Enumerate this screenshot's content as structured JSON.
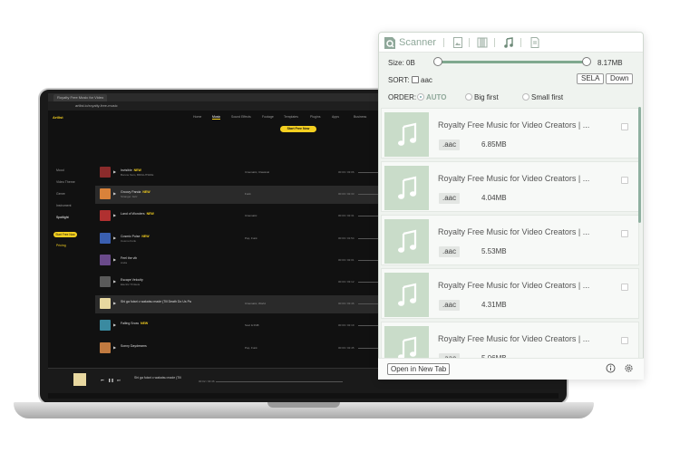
{
  "laptop": {
    "browser_tab": "Royalty Free Music for Video",
    "url": "artlist.io/royalty-free-music",
    "site_logo": "Artlist",
    "nav_items": [
      "Home",
      "Music",
      "Sound Effects",
      "Footage",
      "Templates",
      "Plugins",
      "Apps",
      "Business"
    ],
    "cta": "Start Free Now",
    "sidebar": [
      "Mood",
      "Video Theme",
      "Genre",
      "Instrument",
      "Spotlight"
    ],
    "sidebar_cta": "Start Free Now",
    "sidebar_pricing": "Pricing",
    "tracks": [
      {
        "title": "Invisible",
        "badge": "NEW",
        "artist": "Bonnie Sam, BRIGHTSIDE",
        "genre": "Cinematic, Classical",
        "duration": "00:00 / 03:06",
        "color": "#8a2b2b"
      },
      {
        "title": "Groovy Panda",
        "badge": "NEW",
        "artist": "Stranger Jazz",
        "genre": "Funk",
        "duration": "00:00 / 02:33",
        "color": "#d9823a"
      },
      {
        "title": "Land of Wonders",
        "badge": "NEW",
        "artist": "",
        "genre": "Cinematic",
        "duration": "00:00 / 02:31",
        "color": "#b03030"
      },
      {
        "title": "Cosmic Pulse",
        "badge": "NEW",
        "artist": "Cosmo Funk",
        "genre": "Pop, Funk",
        "duration": "00:00 / 01:54",
        "color": "#3a5fb0"
      },
      {
        "title": "Feel the vib",
        "badge": "",
        "artist": "Anda",
        "genre": "",
        "duration": "00:00 / 02:01",
        "color": "#6a4a8a"
      },
      {
        "title": "Escape Velocity",
        "badge": "",
        "artist": "Electric Trinkets",
        "genre": "",
        "duration": "00:00 / 03:12",
        "color": "#5a5a5a"
      },
      {
        "title": "Shi ga futari o wakatsu made (Till Death Do Us Pa",
        "badge": "",
        "artist": "",
        "genre": "Cinematic, World",
        "duration": "00:00 / 03:46",
        "color": "#e8d8a0"
      },
      {
        "title": "Falling Snow",
        "badge": "NEW",
        "artist": "",
        "genre": "Soul & RnB",
        "duration": "00:00 / 02:19",
        "color": "#3a8aa0"
      },
      {
        "title": "Sonny Daydreams",
        "badge": "",
        "artist": "",
        "genre": "Pop, Funk",
        "duration": "00:00 / 02:45",
        "color": "#c07a40"
      }
    ],
    "player": {
      "title": "Shi ga futari o wakatsu made (Till",
      "time": "00:02 / 03:46"
    }
  },
  "popup": {
    "app_name": "Scanner",
    "tabs": [
      "image-tab-icon",
      "video-tab-icon",
      "music-tab-icon",
      "document-tab-icon"
    ],
    "active_tab": "music",
    "size_label": "Size: 0B",
    "size_max": "8.17MB",
    "size_range_fraction": [
      0.0,
      1.0
    ],
    "sort_label": "SORT:",
    "sort_filter": "aac",
    "select_all_button": "SELA",
    "download_button": "Down",
    "order_label": "ORDER:",
    "order_options": [
      "AUTO",
      "Big first",
      "Small first"
    ],
    "order_selected": "AUTO",
    "files": [
      {
        "title": "Royalty Free Music for Video Creators | ...",
        "ext": ".aac",
        "size": "6.85MB"
      },
      {
        "title": "Royalty Free Music for Video Creators | ...",
        "ext": ".aac",
        "size": "4.04MB"
      },
      {
        "title": "Royalty Free Music for Video Creators | ...",
        "ext": ".aac",
        "size": "5.53MB"
      },
      {
        "title": "Royalty Free Music for Video Creators | ...",
        "ext": ".aac",
        "size": "4.31MB"
      },
      {
        "title": "Royalty Free Music for Video Creators | ...",
        "ext": ".aac",
        "size": "5.06MB"
      }
    ],
    "open_new_tab": "Open in New Tab",
    "accent": "#8fa89a"
  }
}
